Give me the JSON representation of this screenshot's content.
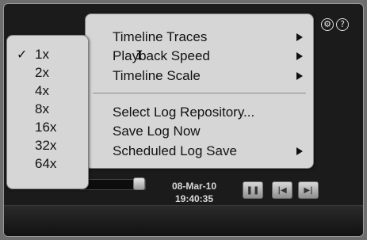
{
  "header": {
    "settings_icon": "gear-circle-icon",
    "help_symbol": "?",
    "settings_symbol": "⚙"
  },
  "player": {
    "date": "08-Mar-10",
    "time": "19:40:35",
    "buttons": [
      "pause",
      "step-back",
      "step-forward"
    ]
  },
  "main_menu": {
    "items": [
      {
        "label": "Timeline Traces",
        "has_submenu": true
      },
      {
        "label": "Playback Speed",
        "has_submenu": true
      },
      {
        "label": "Timeline Scale",
        "has_submenu": true
      },
      {
        "label": "Select Log Repository...",
        "has_submenu": false
      },
      {
        "label": "Save Log Now",
        "has_submenu": false
      },
      {
        "label": "Scheduled Log Save",
        "has_submenu": true
      }
    ]
  },
  "speed_menu": {
    "items": [
      {
        "label": "1x",
        "checked": true
      },
      {
        "label": "2x",
        "checked": false
      },
      {
        "label": "4x",
        "checked": false
      },
      {
        "label": "8x",
        "checked": false
      },
      {
        "label": "16x",
        "checked": false
      },
      {
        "label": "32x",
        "checked": false
      },
      {
        "label": "64x",
        "checked": false
      }
    ],
    "check_symbol": "✓"
  }
}
